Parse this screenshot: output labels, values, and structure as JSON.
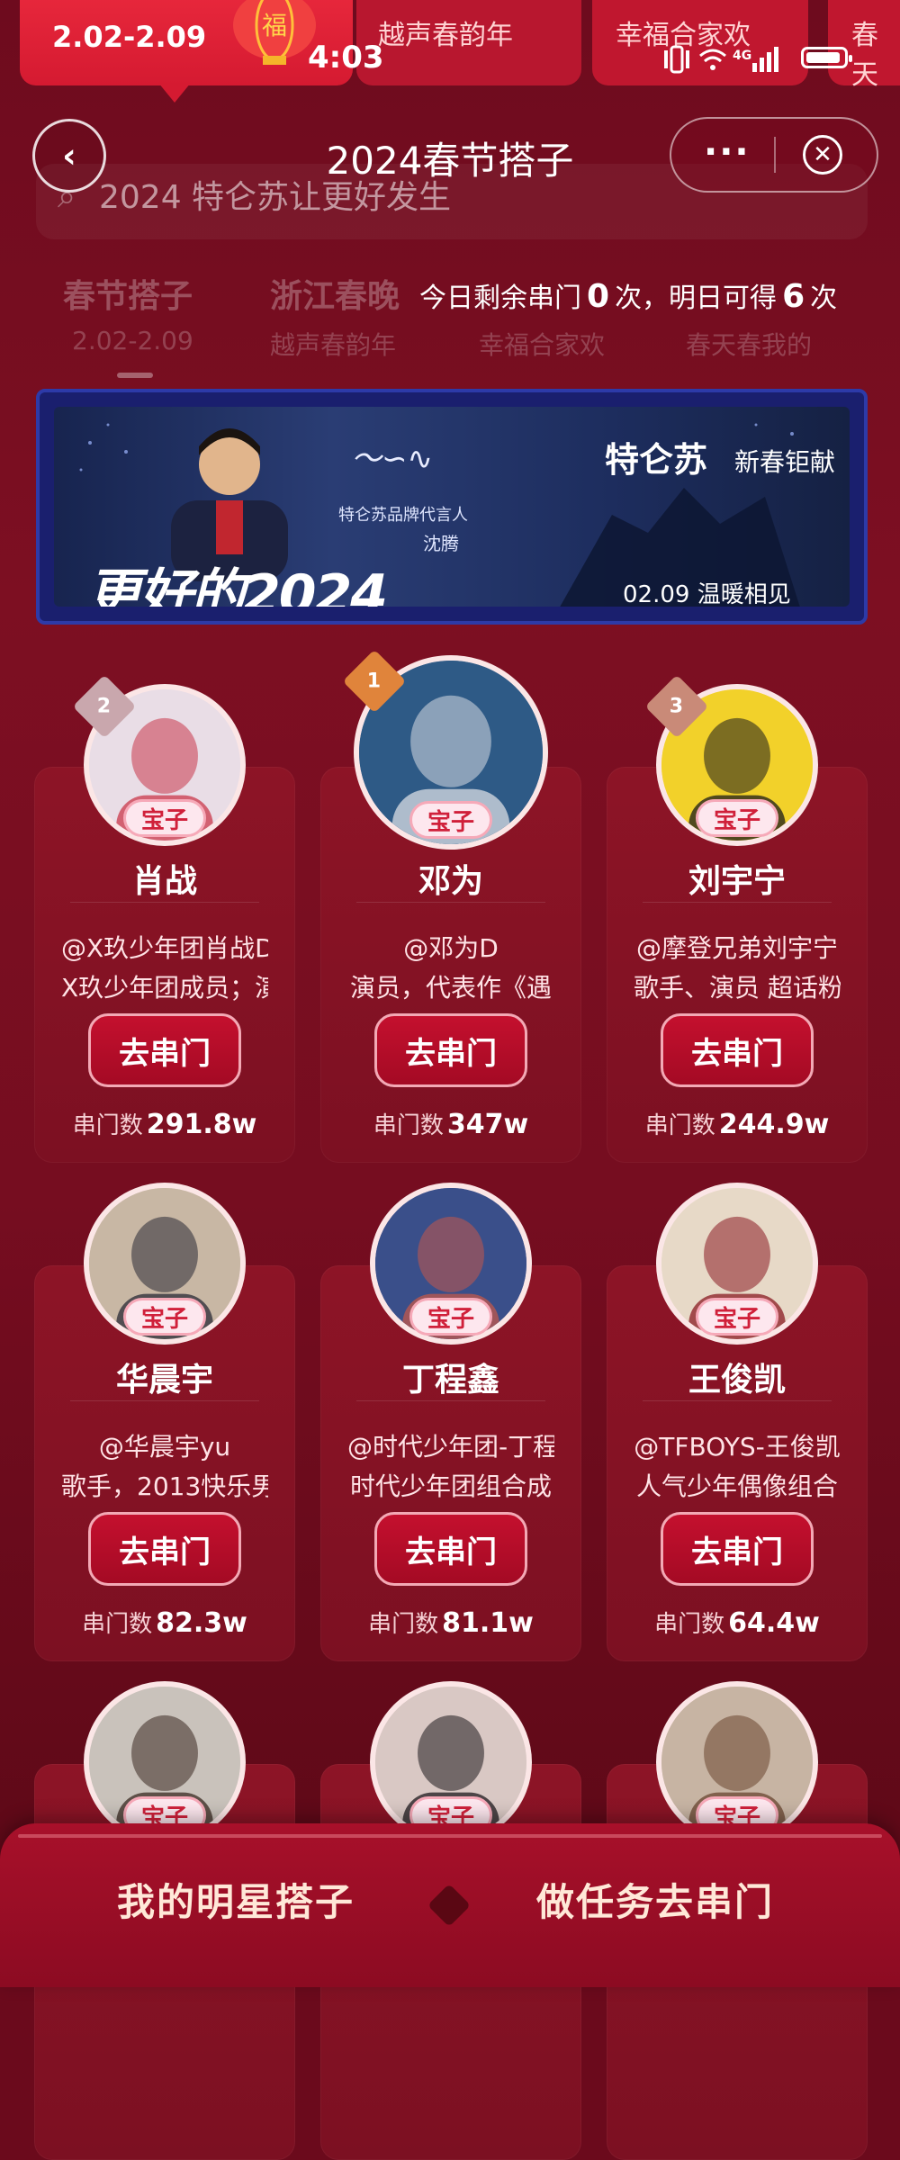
{
  "status_bar": {
    "time": "4:03",
    "icons": "📳 ‡ 4G▌"
  },
  "top_strip": {
    "active_date": "2.02-2.09",
    "items": [
      "越声春韵年",
      "幸福合家欢",
      "春天"
    ]
  },
  "nav": {
    "title": "2024春节搭子",
    "more": "···",
    "close": "✕",
    "back": "‹"
  },
  "search": {
    "placeholder": "2024 特仑苏让更好发生"
  },
  "categories": [
    {
      "label": "春节搭子",
      "sub": "2.02-2.09"
    },
    {
      "label": "浙江春晚",
      "sub": "越声春韵年"
    },
    {
      "label": "",
      "sub": "幸福合家欢"
    },
    {
      "label": "",
      "sub": "春天春我的"
    }
  ],
  "quota": {
    "prefix": "今日剩余串门",
    "remaining": "0",
    "mid": "次，明日可得",
    "tomorrow": "6",
    "suffix": "次"
  },
  "banner": {
    "slogan": "更好的2024",
    "signature": "沈腾",
    "subtitle": "特仑苏品牌代言人",
    "name": "沈腾",
    "brand": "特仑苏",
    "gift": "新春钜献",
    "date": "02.09 温暖相见"
  },
  "stars": [
    {
      "rank": "2",
      "name": "肖战",
      "handle": "@X玖少年团肖战D",
      "desc": "X玖少年团成员；演",
      "tag": "宝子",
      "button": "去串门",
      "visits_label": "串门数",
      "visits": "291.8w",
      "avatar_color": "#e9dde6",
      "avatar_accent": "#c9374a"
    },
    {
      "rank": "1",
      "name": "邓为",
      "handle": "@邓为D",
      "desc": "演员，代表作《遇",
      "tag": "宝子",
      "button": "去串门",
      "visits_label": "串门数",
      "visits": "347w",
      "avatar_color": "#2e5a86",
      "avatar_accent": "#d9dde3"
    },
    {
      "rank": "3",
      "name": "刘宇宁",
      "handle": "@摩登兄弟刘宇宁",
      "desc": "歌手、演员 超话粉",
      "tag": "宝子",
      "button": "去串门",
      "visits_label": "串门数",
      "visits": "244.9w",
      "avatar_color": "#f2d12a",
      "avatar_accent": "#1b1b1b"
    },
    {
      "rank": "",
      "name": "华晨宇",
      "handle": "@华晨宇yu",
      "desc": "歌手，2013快乐男",
      "tag": "宝子",
      "button": "去串门",
      "visits_label": "串门数",
      "visits": "82.3w",
      "avatar_color": "#c8b7a4",
      "avatar_accent": "#2a2a35"
    },
    {
      "rank": "",
      "name": "丁程鑫",
      "handle": "@时代少年团-丁程",
      "desc": "时代少年团组合成",
      "tag": "宝子",
      "button": "去串门",
      "visits_label": "串门数",
      "visits": "81.1w",
      "avatar_color": "#3a4f8a",
      "avatar_accent": "#c2574a"
    },
    {
      "rank": "",
      "name": "王俊凯",
      "handle": "@TFBOYS-王俊凯",
      "desc": "人气少年偶像组合",
      "tag": "宝子",
      "button": "去串门",
      "visits_label": "串门数",
      "visits": "64.4w",
      "avatar_color": "#e7d9c7",
      "avatar_accent": "#8a1a22"
    },
    {
      "rank": "",
      "name": "",
      "handle": "",
      "desc": "",
      "tag": "宝子",
      "button": "",
      "visits_label": "",
      "visits": "",
      "avatar_color": "#c9c2bb",
      "avatar_accent": "#3a2a22"
    },
    {
      "rank": "",
      "name": "",
      "handle": "",
      "desc": "",
      "tag": "宝子",
      "button": "",
      "visits_label": "",
      "visits": "",
      "avatar_color": "#d9c8c4",
      "avatar_accent": "#1d1a1d"
    },
    {
      "rank": "",
      "name": "",
      "handle": "",
      "desc": "",
      "tag": "宝子",
      "button": "",
      "visits_label": "",
      "visits": "",
      "avatar_color": "#c7b4a3",
      "avatar_accent": "#6a4630"
    }
  ],
  "bottom_bar": {
    "left": "我的明星搭子",
    "right": "做任务去串门"
  },
  "colors": {
    "background": "#6b0a1c",
    "card": "#8d1426",
    "accent": "#d0203a",
    "rank1": "#e0843b",
    "rank2": "#c9a7ad",
    "rank3": "#c98a78"
  }
}
